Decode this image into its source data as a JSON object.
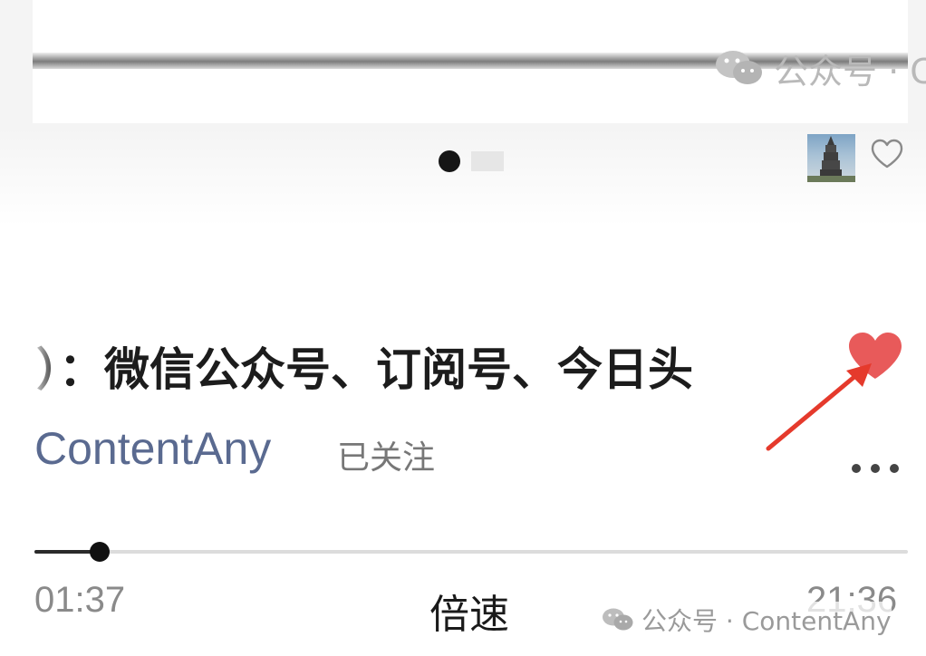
{
  "card": {
    "watermark_text": "公众号 · C",
    "watermark_icon": "wechat-icon"
  },
  "carousel": {
    "pages": 2,
    "active_index": 0
  },
  "episode": {
    "title": "）：微信公众号、订阅号、今日头",
    "author": "ContentAny",
    "follow_status": "已关注",
    "liked": true
  },
  "player": {
    "current_time": "01:37",
    "total_time": "21:36",
    "speed_label": "倍速",
    "progress": 0.075
  },
  "watermark": {
    "text": "公众号 · ContentAny",
    "icon": "wechat-icon"
  },
  "colors": {
    "like_red": "#e85a5a",
    "arrow_red": "#e53a2c",
    "author_blue": "#5a6a90"
  }
}
